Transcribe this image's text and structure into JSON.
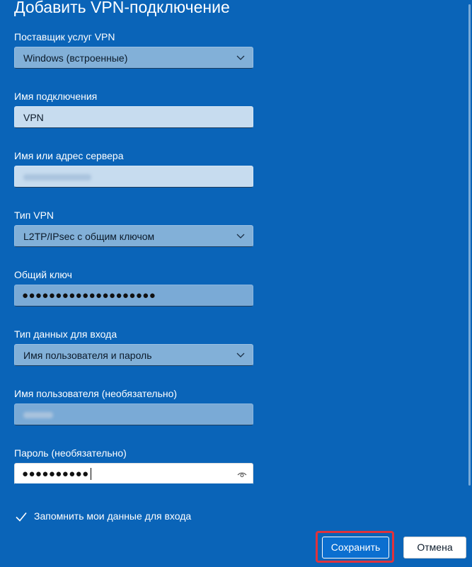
{
  "dialog": {
    "title": "Добавить VPN-подключение"
  },
  "provider": {
    "label": "Поставщик услуг VPN",
    "value": "Windows (встроенные)"
  },
  "connection_name": {
    "label": "Имя подключения",
    "value": "VPN"
  },
  "server": {
    "label": "Имя или адрес сервера",
    "value_obscured": true
  },
  "vpn_type": {
    "label": "Тип VPN",
    "value": "L2TP/IPsec с общим ключом"
  },
  "preshared_key": {
    "label": "Общий ключ",
    "masked": "●●●●●●●●●●●●●●●●●●●●"
  },
  "signin_type": {
    "label": "Тип данных для входа",
    "value": "Имя пользователя и пароль"
  },
  "username": {
    "label": "Имя пользователя (необязательно)",
    "value_obscured": true
  },
  "password": {
    "label": "Пароль (необязательно)",
    "masked": "●●●●●●●●●●"
  },
  "remember": {
    "label": "Запомнить мои данные для входа",
    "checked": true
  },
  "buttons": {
    "save": "Сохранить",
    "cancel": "Отмена"
  },
  "colors": {
    "background": "#0a64b8",
    "highlight": "#e0323c"
  },
  "icons": {
    "dropdown": "chevron-down-icon",
    "reveal": "eye-icon",
    "checkbox": "checkmark-icon"
  }
}
